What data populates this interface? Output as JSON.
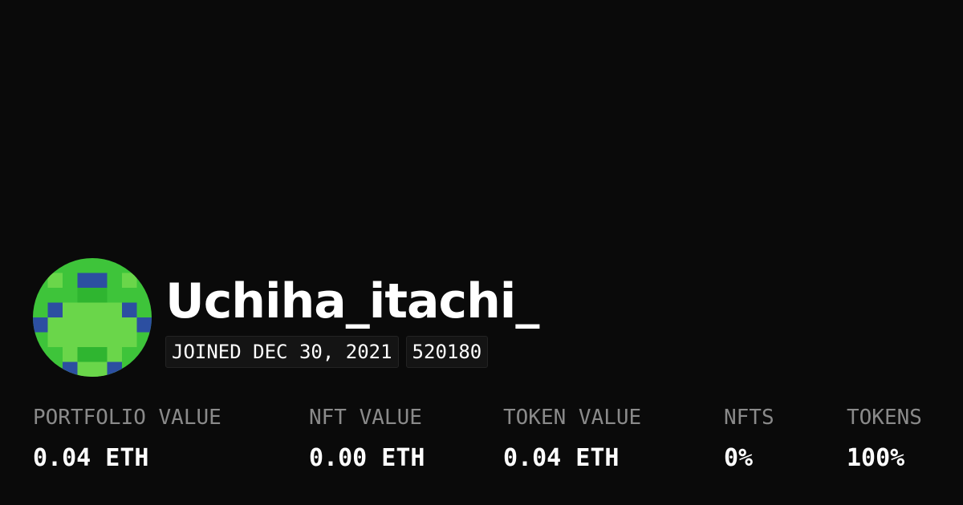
{
  "profile": {
    "username": "Uchiha_itachi_",
    "joined": "JOINED DEC 30, 2021",
    "id": "520180",
    "avatar": "pixel-avatar",
    "avatar_colors": [
      "#3ec43a",
      "#6ad64a",
      "#2c4fa1"
    ]
  },
  "stats": [
    {
      "label": "PORTFOLIO VALUE",
      "value": "0.04 ETH"
    },
    {
      "label": "NFT VALUE",
      "value": "0.00 ETH"
    },
    {
      "label": "TOKEN VALUE",
      "value": "0.04 ETH"
    },
    {
      "label": "NFTS",
      "value": "0%"
    },
    {
      "label": "TOKENS",
      "value": "100%"
    }
  ]
}
